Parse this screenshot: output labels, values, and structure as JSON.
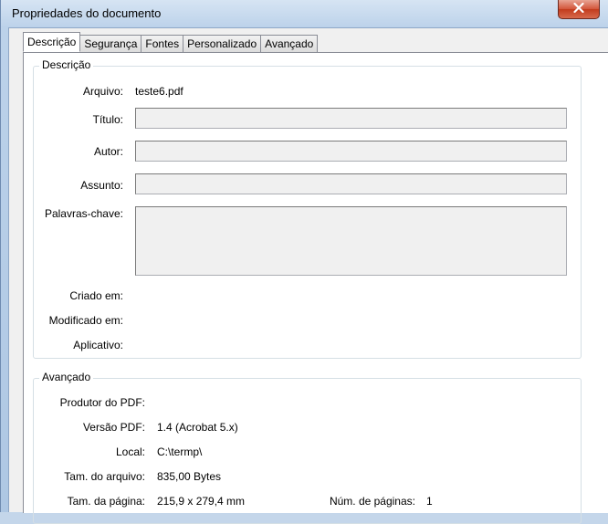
{
  "window": {
    "title": "Propriedades do documento",
    "close_glyph": "✕"
  },
  "tabs": [
    {
      "label": "Descrição",
      "active": true
    },
    {
      "label": "Segurança",
      "active": false
    },
    {
      "label": "Fontes",
      "active": false
    },
    {
      "label": "Personalizado",
      "active": false
    },
    {
      "label": "Avançado",
      "active": false
    }
  ],
  "description": {
    "group_title": "Descrição",
    "file_label": "Arquivo:",
    "file_value": "teste6.pdf",
    "title_label": "Título:",
    "title_value": "",
    "author_label": "Autor:",
    "author_value": "",
    "subject_label": "Assunto:",
    "subject_value": "",
    "keywords_label": "Palavras-chave:",
    "keywords_value": "",
    "created_label": "Criado em:",
    "created_value": "",
    "modified_label": "Modificado em:",
    "modified_value": "",
    "application_label": "Aplicativo:",
    "application_value": ""
  },
  "advanced": {
    "group_title": "Avançado",
    "producer_label": "Produtor do PDF:",
    "producer_value": "",
    "version_label": "Versão PDF:",
    "version_value": "1.4 (Acrobat 5.x)",
    "location_label": "Local:",
    "location_value": "C:\\termp\\",
    "filesize_label": "Tam. do arquivo:",
    "filesize_value": "835,00 Bytes",
    "pagesize_label": "Tam. da página:",
    "pagesize_value": "215,9 x 279,4 mm",
    "pages_label": "Núm. de páginas:",
    "pages_value": "1"
  },
  "colors": {
    "close_button": "#c23b1d",
    "panel_background": "#ffffff",
    "field_background": "#f0f0f0"
  }
}
